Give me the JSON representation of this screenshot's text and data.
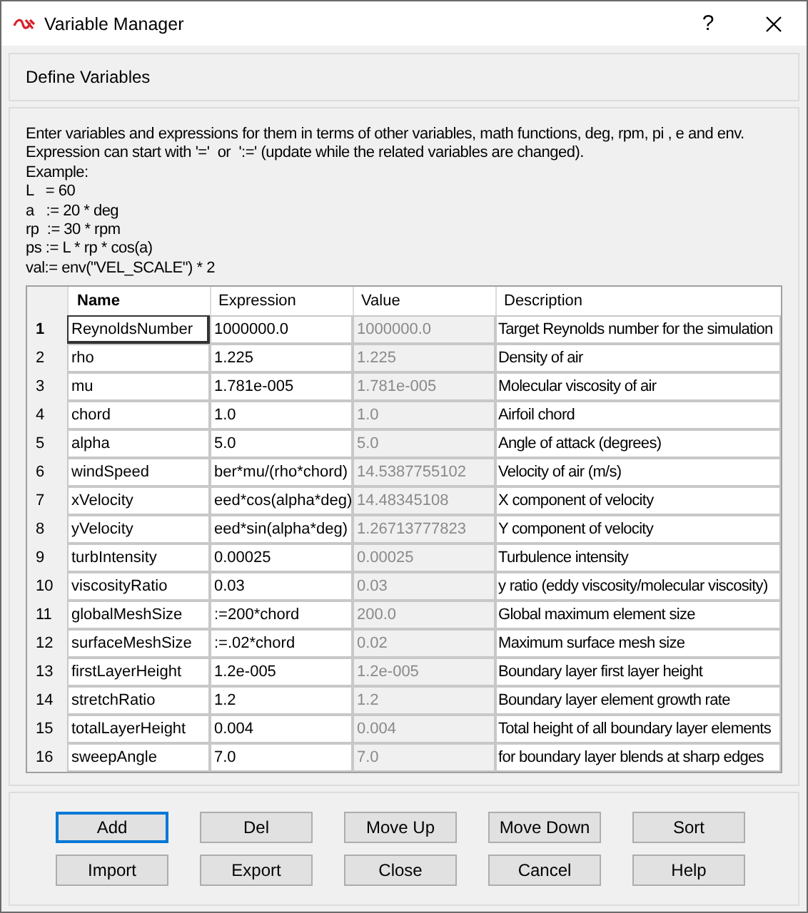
{
  "window": {
    "title": "Variable Manager",
    "help": "?"
  },
  "header": {
    "title": "Define Variables"
  },
  "instructions": [
    "Enter variables and expressions for them in terms of other variables, math functions, deg, rpm, pi , e and env.",
    "Expression can start with '='  or  ':=' (update while the related variables are changed).",
    "Example:",
    "L   = 60",
    "a   := 20 * deg",
    "rp  := 30 * rpm",
    "ps := L * rp * cos(a)",
    "val:= env(\"VEL_SCALE\") * 2"
  ],
  "table": {
    "columns": [
      "Name",
      "Expression",
      "Value",
      "Description"
    ],
    "rows": [
      {
        "index": "1",
        "name": "ReynoldsNumber",
        "expression": "1000000.0",
        "value": "1000000.0",
        "description": "Target Reynolds number for the simulation",
        "selected": true
      },
      {
        "index": "2",
        "name": "rho",
        "expression": "1.225",
        "value": "1.225",
        "description": "Density of air",
        "selected": false
      },
      {
        "index": "3",
        "name": "mu",
        "expression": "1.781e-005",
        "value": "1.781e-005",
        "description": "Molecular viscosity of air",
        "selected": false
      },
      {
        "index": "4",
        "name": "chord",
        "expression": "1.0",
        "value": "1.0",
        "description": "Airfoil chord",
        "selected": false
      },
      {
        "index": "5",
        "name": "alpha",
        "expression": "5.0",
        "value": "5.0",
        "description": "Angle of attack (degrees)",
        "selected": false
      },
      {
        "index": "6",
        "name": "windSpeed",
        "expression": "ber*mu/(rho*chord)",
        "value": "14.5387755102",
        "description": "Velocity of air (m/s)",
        "selected": false
      },
      {
        "index": "7",
        "name": "xVelocity",
        "expression": "eed*cos(alpha*deg)",
        "value": "14.48345108",
        "description": "X component of velocity",
        "selected": false
      },
      {
        "index": "8",
        "name": "yVelocity",
        "expression": "eed*sin(alpha*deg)",
        "value": "1.26713777823",
        "description": "Y component of velocity",
        "selected": false
      },
      {
        "index": "9",
        "name": "turbIntensity",
        "expression": "0.00025",
        "value": "0.00025",
        "description": "Turbulence intensity",
        "selected": false
      },
      {
        "index": "10",
        "name": "viscosityRatio",
        "expression": "0.03",
        "value": "0.03",
        "description": "y ratio (eddy viscosity/molecular viscosity)",
        "selected": false
      },
      {
        "index": "11",
        "name": "globalMeshSize",
        "expression": ":=200*chord",
        "value": "200.0",
        "description": "Global maximum element size",
        "selected": false
      },
      {
        "index": "12",
        "name": "surfaceMeshSize",
        "expression": ":=.02*chord",
        "value": "0.02",
        "description": "Maximum surface mesh size",
        "selected": false
      },
      {
        "index": "13",
        "name": "firstLayerHeight",
        "expression": "1.2e-005",
        "value": "1.2e-005",
        "description": "Boundary layer first layer height",
        "selected": false
      },
      {
        "index": "14",
        "name": "stretchRatio",
        "expression": "1.2",
        "value": "1.2",
        "description": "Boundary layer element growth rate",
        "selected": false
      },
      {
        "index": "15",
        "name": "totalLayerHeight",
        "expression": "0.004",
        "value": "0.004",
        "description": "Total height of all boundary layer elements",
        "selected": false
      },
      {
        "index": "16",
        "name": "sweepAngle",
        "expression": "7.0",
        "value": "7.0",
        "description": "for boundary layer blends at sharp edges",
        "selected": false
      }
    ]
  },
  "buttons": [
    {
      "label": "Add",
      "focused": true
    },
    {
      "label": "Del",
      "focused": false
    },
    {
      "label": "Move Up",
      "focused": false
    },
    {
      "label": "Move Down",
      "focused": false
    },
    {
      "label": "Sort",
      "focused": false
    },
    {
      "label": "Import",
      "focused": false
    },
    {
      "label": "Export",
      "focused": false
    },
    {
      "label": "Close",
      "focused": false
    },
    {
      "label": "Cancel",
      "focused": false
    },
    {
      "label": "Help",
      "focused": false
    }
  ]
}
